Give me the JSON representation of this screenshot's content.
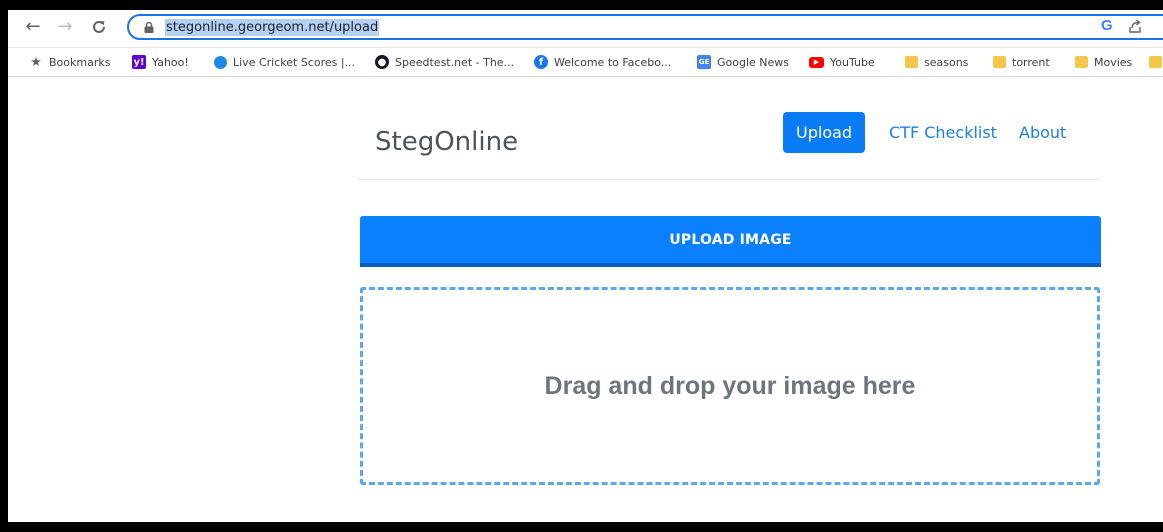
{
  "browser": {
    "url": "stegonline.georgeom.net/upload",
    "bookmarks": [
      {
        "label": "Bookmarks",
        "icon": "star-icon"
      },
      {
        "label": "Yahoo!",
        "icon": "yahoo-icon"
      },
      {
        "label": "Live Cricket Scores |...",
        "icon": "cricket-icon"
      },
      {
        "label": "Speedtest.net - The...",
        "icon": "speedtest-icon"
      },
      {
        "label": "Welcome to Facebo...",
        "icon": "facebook-icon"
      },
      {
        "label": "Google News",
        "icon": "google-news-icon"
      },
      {
        "label": "YouTube",
        "icon": "youtube-icon"
      },
      {
        "label": "seasons",
        "icon": "folder-icon"
      },
      {
        "label": "torrent",
        "icon": "folder-icon"
      },
      {
        "label": "Movies",
        "icon": "folder-icon"
      }
    ],
    "icons": {
      "back": "back-arrow-icon",
      "forward": "forward-arrow-icon",
      "reload": "reload-icon",
      "lock": "lock-icon",
      "google": "google-icon",
      "share": "share-icon"
    }
  },
  "page": {
    "brand": "StegOnline",
    "nav": [
      {
        "label": "Upload",
        "active": true
      },
      {
        "label": "CTF Checklist",
        "active": false
      },
      {
        "label": "About",
        "active": false
      }
    ],
    "upload_button": "UPLOAD IMAGE",
    "dropzone_text": "Drag and drop your image here"
  },
  "colors": {
    "accent": "#0a80ff",
    "dropzone_border": "#5aa8f0",
    "brand_text": "#4b545c"
  }
}
